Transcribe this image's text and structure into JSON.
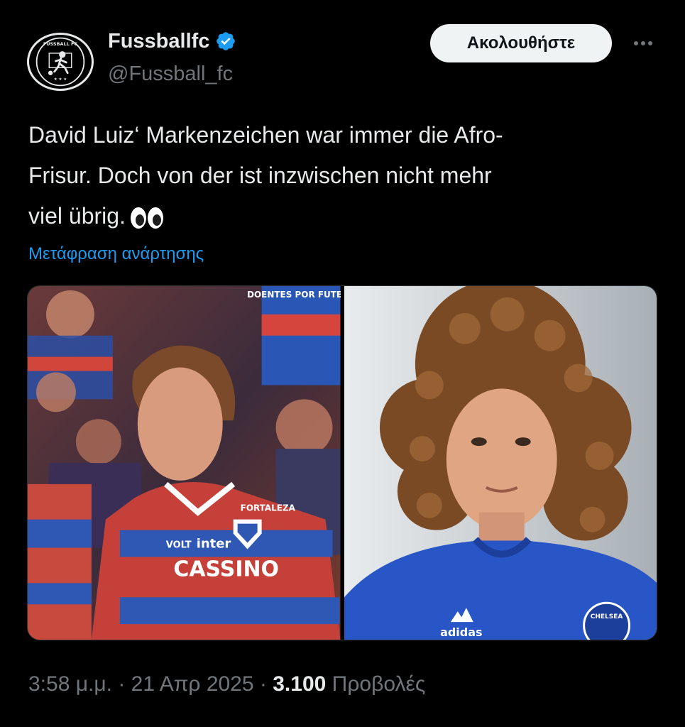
{
  "author": {
    "display_name": "Fussballfc",
    "handle": "@Fussball_fc",
    "avatar_text": "FUSSBALL FC",
    "verified": true
  },
  "actions": {
    "follow_label": "Ακολουθήστε"
  },
  "tweet": {
    "lines": [
      "David Luiz‘ Markenzeichen war immer die Afro-",
      "Frisur. Doch von der ist inzwischen nicht mehr",
      "viel übrig."
    ],
    "emoji": "eyes-icon",
    "translate_label": "Μετάφραση ανάρτησης"
  },
  "media": {
    "left_photo": {
      "description_icon": "player-short-hair-photo",
      "watermark": "DOENTES POR FUTEBOL",
      "shirt_sponsor": "CASSINO",
      "shirt_brands": [
        "VOLT",
        "inter"
      ],
      "shirt_club": "FORTALEZA"
    },
    "right_photo": {
      "description_icon": "player-curly-hair-photo",
      "shirt_badge": "CHELSEA",
      "kit_brand": "adidas"
    }
  },
  "meta": {
    "time": "3:58 μ.μ.",
    "separator": "·",
    "date": "21 Απρ 2025",
    "views_count": "3.100",
    "views_label": "Προβολές"
  },
  "colors": {
    "accent": "#1d9bf0",
    "background": "#000000",
    "text_primary": "#e7e9ea",
    "text_secondary": "#71767b",
    "follow_bg": "#eff3f4"
  }
}
